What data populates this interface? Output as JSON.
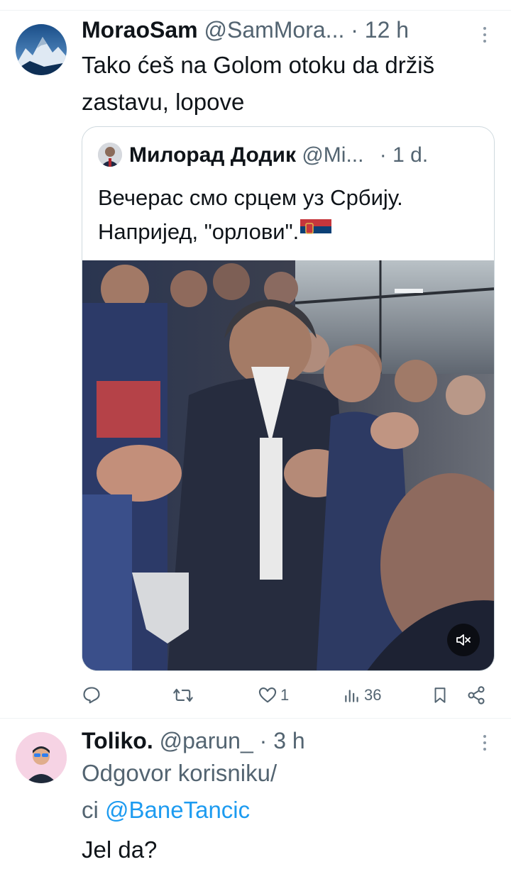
{
  "tweet": {
    "author_name": "MoraoSam",
    "author_handle": "@SamMora...",
    "time": "· 12 h",
    "text_line1": "Tako ćeš na Golom otoku da držiš",
    "text_line2": "zastavu, lopove",
    "avatar_icon": "mountain-avatar"
  },
  "quoted": {
    "author_name": "Милорад Додик",
    "author_handle": "@Mi...",
    "time": "· 1 d.",
    "text_line1": "Вечерас смо срцем уз Србију.",
    "text_line2": "Напријед, \"орлови\".",
    "flag_emoji": "🇷🇸",
    "media_icon": "video-thumbnail",
    "mute_icon": "speaker-muted-icon"
  },
  "actions": {
    "reply_count": "",
    "retweet_count": "",
    "like_count": "1",
    "views_count": "36"
  },
  "reply": {
    "author_name": "Toliko.",
    "author_handle": "@parun_",
    "time": "· 3 h",
    "context_line1": "Odgovor korisniku/",
    "context_prefix": "ci",
    "mention": "@BaneTancic",
    "text": "Jel da?"
  },
  "colors": {
    "text": "#0f1419",
    "muted": "#536471",
    "link": "#1d9bf0",
    "border": "#cfd9de",
    "serbia_red": "#c6363c",
    "serbia_blue": "#0c4076"
  }
}
